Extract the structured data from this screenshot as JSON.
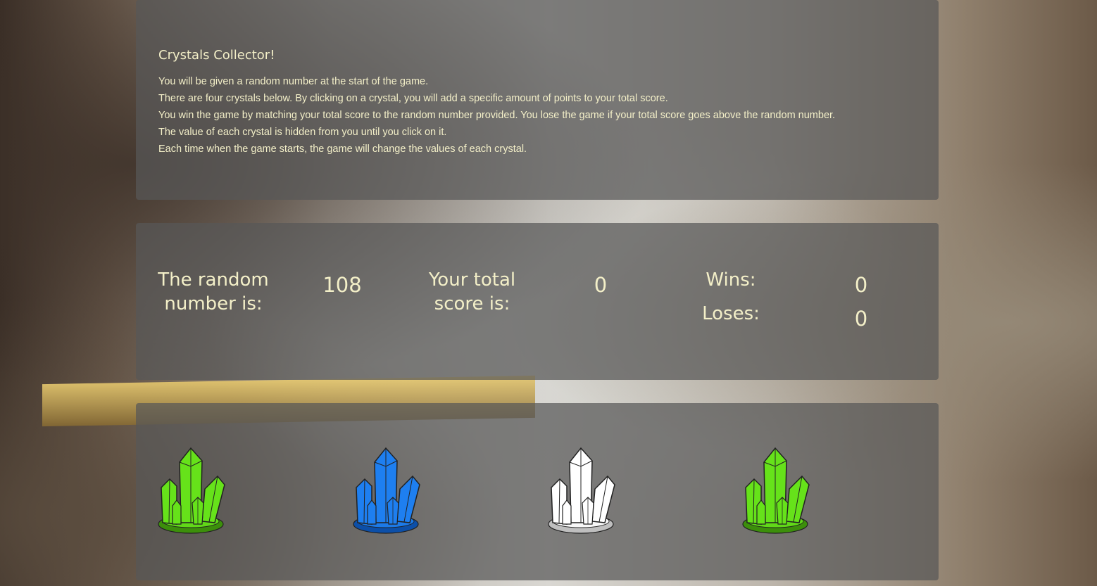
{
  "intro": {
    "title": "Crystals Collector!",
    "rules": [
      "You will be given a random number at the start of the game.",
      "There are four crystals below. By clicking on a crystal, you will add a specific amount of points to your total score.",
      "You win the game by matching your total score to the random number provided. You lose the game if your total score goes above the random number.",
      "The value of each crystal is hidden from you until you click on it.",
      "Each time when the game starts, the game will change the values of each crystal."
    ]
  },
  "scoreboard": {
    "random_label": "The random number is:",
    "random_value": "108",
    "total_label": "Your total score is:",
    "total_value": "0",
    "wins_label": "Wins:",
    "wins_value": "0",
    "loses_label": "Loses:",
    "loses_value": "0"
  },
  "crystals": [
    {
      "name": "green-crystal-icon",
      "color": "#66e21a",
      "dark": "#3c8f0b"
    },
    {
      "name": "blue-crystal-icon",
      "color": "#1e7ff0",
      "dark": "#0c4fa8"
    },
    {
      "name": "white-crystal-icon",
      "color": "#ffffff",
      "dark": "#bfbfbf"
    },
    {
      "name": "green-crystal-icon",
      "color": "#66e21a",
      "dark": "#3c8f0b"
    }
  ],
  "theme": {
    "panel_bg": "rgba(88,88,88,0.72)",
    "text_color": "#f3efc8"
  }
}
